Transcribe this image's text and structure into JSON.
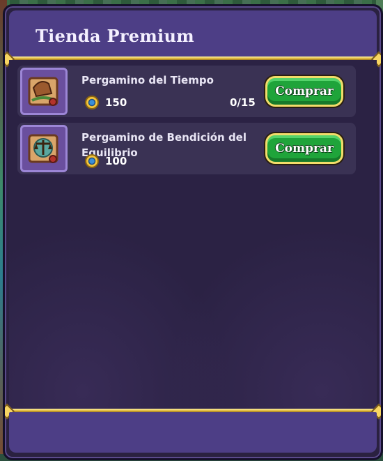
{
  "shop": {
    "title": "Tienda Premium",
    "items": [
      {
        "name": "Pergamino del Tiempo",
        "icon": "time-scroll-icon",
        "price": "150",
        "stock": "0/15",
        "buy_label": "Comprar"
      },
      {
        "name": "Pergamino de Bendición del Equilibrio",
        "icon": "balance-scroll-icon",
        "price": "100",
        "buy_label": "Comprar"
      }
    ],
    "currency_icon": "coin-icon"
  },
  "colors": {
    "panel": "#2a2140",
    "header": "#4d3e86",
    "gold": "#e2b93a",
    "button": "#1fa43a"
  }
}
